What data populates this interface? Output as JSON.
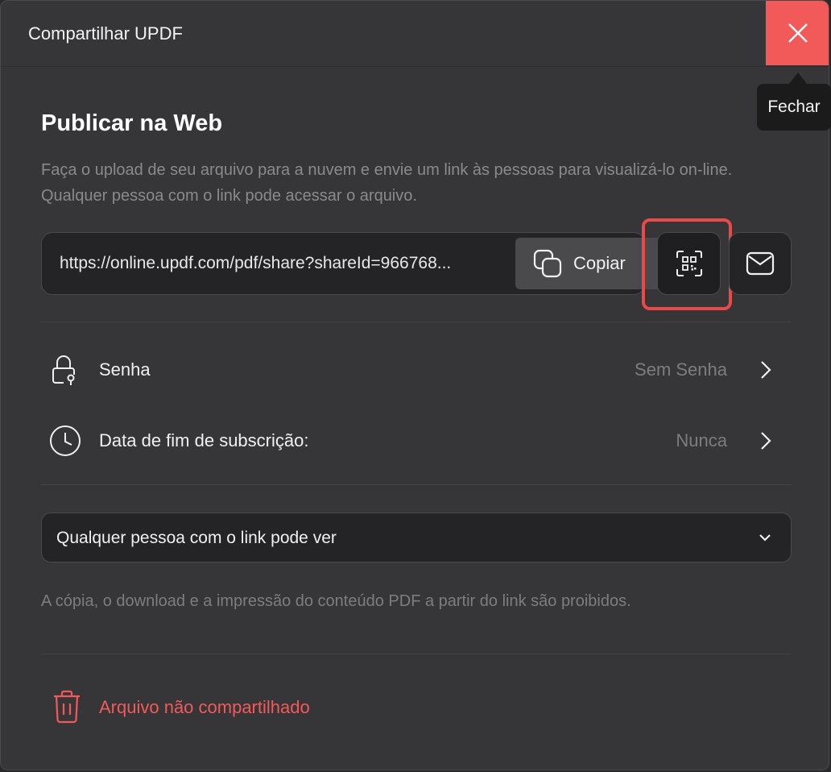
{
  "dialog": {
    "title": "Compartilhar UPDF",
    "close_tooltip": "Fechar"
  },
  "publish": {
    "heading": "Publicar na Web",
    "description": "Faça o upload de seu arquivo para a nuvem e envie um link às pessoas para visualizá-lo on-line. Qualquer pessoa com o link pode acessar o arquivo.",
    "link": "https://online.updf.com/pdf/share?shareId=966768...",
    "copy_label": "Copiar"
  },
  "settings": {
    "password": {
      "label": "Senha",
      "value": "Sem Senha"
    },
    "expiry": {
      "label": "Data de fim de subscrição:",
      "value": "Nunca"
    }
  },
  "access": {
    "selected": "Qualquer pessoa com o link pode ver",
    "note": "A cópia, o download e a impressão do conteúdo PDF a partir do link são proibidos."
  },
  "unshare": {
    "label": "Arquivo não compartilhado"
  },
  "colors": {
    "background": "#363638",
    "close_button": "#f25a5a",
    "highlight": "#ea4949",
    "danger_text": "#f25a5a",
    "muted_text": "#8a8a8d"
  },
  "icons": [
    "close-icon",
    "copy-icon",
    "qr-code-icon",
    "mail-icon",
    "lock-icon",
    "clock-icon",
    "chevron-right-icon",
    "chevron-down-icon",
    "trash-icon"
  ]
}
